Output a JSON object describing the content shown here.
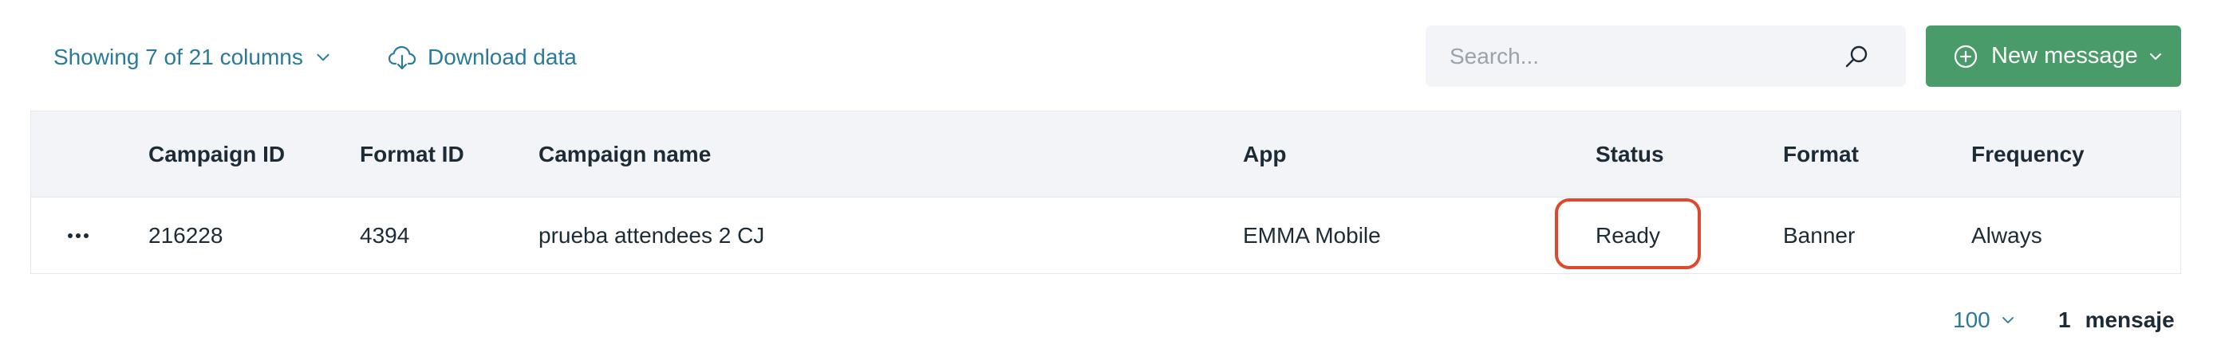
{
  "toolbar": {
    "columns_label": "Showing 7 of 21 columns",
    "download_label": "Download data",
    "search_placeholder": "Search...",
    "new_message_label": "New message"
  },
  "table": {
    "headers": [
      "Campaign ID",
      "Format ID",
      "Campaign name",
      "App",
      "Status",
      "Format",
      "Frequency"
    ],
    "rows": [
      {
        "campaign_id": "216228",
        "format_id": "4394",
        "campaign_name": "prueba attendees 2 CJ",
        "app": "EMMA Mobile",
        "status": "Ready",
        "format": "Banner",
        "frequency": "Always"
      }
    ]
  },
  "footer": {
    "page_size": "100",
    "count": "1",
    "count_label": "mensaje"
  },
  "colors": {
    "link": "#2a7a9a",
    "primary_button": "#4a9b6a",
    "header_bg": "#f3f4f7",
    "highlight": "#e0482e"
  },
  "icons": {
    "columns_chevron": "chevron-down-icon",
    "download": "cloud-download-icon",
    "search": "search-icon",
    "new_message": "plus-circle-icon",
    "new_message_chevron": "chevron-down-icon",
    "row_actions": "more-horizontal-icon",
    "page_size_chevron": "chevron-down-icon"
  }
}
